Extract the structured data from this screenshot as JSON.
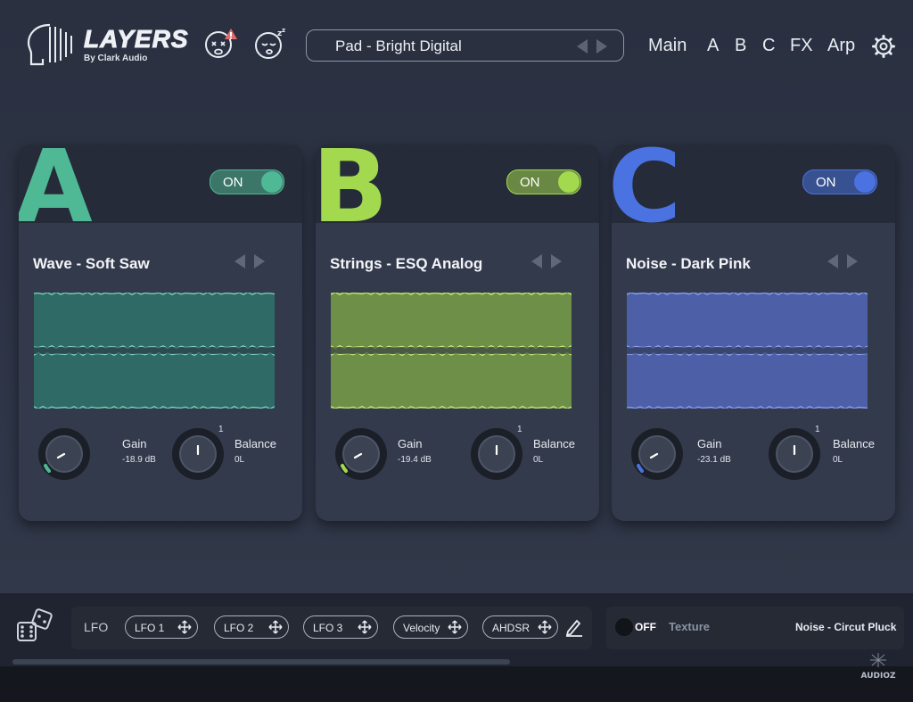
{
  "header": {
    "logo_title": "LAYERS",
    "logo_subtitle": "By Clark Audio",
    "preset_name": "Pad - Bright Digital",
    "nav": [
      "Main",
      "A",
      "B",
      "C",
      "FX",
      "Arp"
    ]
  },
  "layers": [
    {
      "letter": "A",
      "toggle": "ON",
      "preset": "Wave - Soft Saw",
      "gain_label": "Gain",
      "gain_value": "-18.9 dB",
      "balance_label": "Balance",
      "balance_value": "0L",
      "balance_marker": "1",
      "color": "#4fb894",
      "waveform_fill": "#2f6a66",
      "waveform_line": "#7fd6c2"
    },
    {
      "letter": "B",
      "toggle": "ON",
      "preset": "Strings - ESQ Analog",
      "gain_label": "Gain",
      "gain_value": "-19.4 dB",
      "balance_label": "Balance",
      "balance_value": "0L",
      "balance_marker": "1",
      "color": "#a3d94f",
      "waveform_fill": "#6e8f47",
      "waveform_line": "#c8ee7a"
    },
    {
      "letter": "C",
      "toggle": "ON",
      "preset": "Noise - Dark Pink",
      "gain_label": "Gain",
      "gain_value": "-23.1 dB",
      "balance_label": "Balance",
      "balance_value": "0L",
      "balance_marker": "1",
      "color": "#4a72e0",
      "waveform_fill": "#4d5fa6",
      "waveform_line": "#8ea4f2"
    }
  ],
  "bottom": {
    "lfo_label": "LFO",
    "chips": [
      "LFO 1",
      "LFO 2",
      "LFO 3",
      "Velocity",
      "AHDSR"
    ],
    "texture_state": "OFF",
    "texture_label": "Texture",
    "texture_preset": "Noise - Circut Pluck"
  }
}
